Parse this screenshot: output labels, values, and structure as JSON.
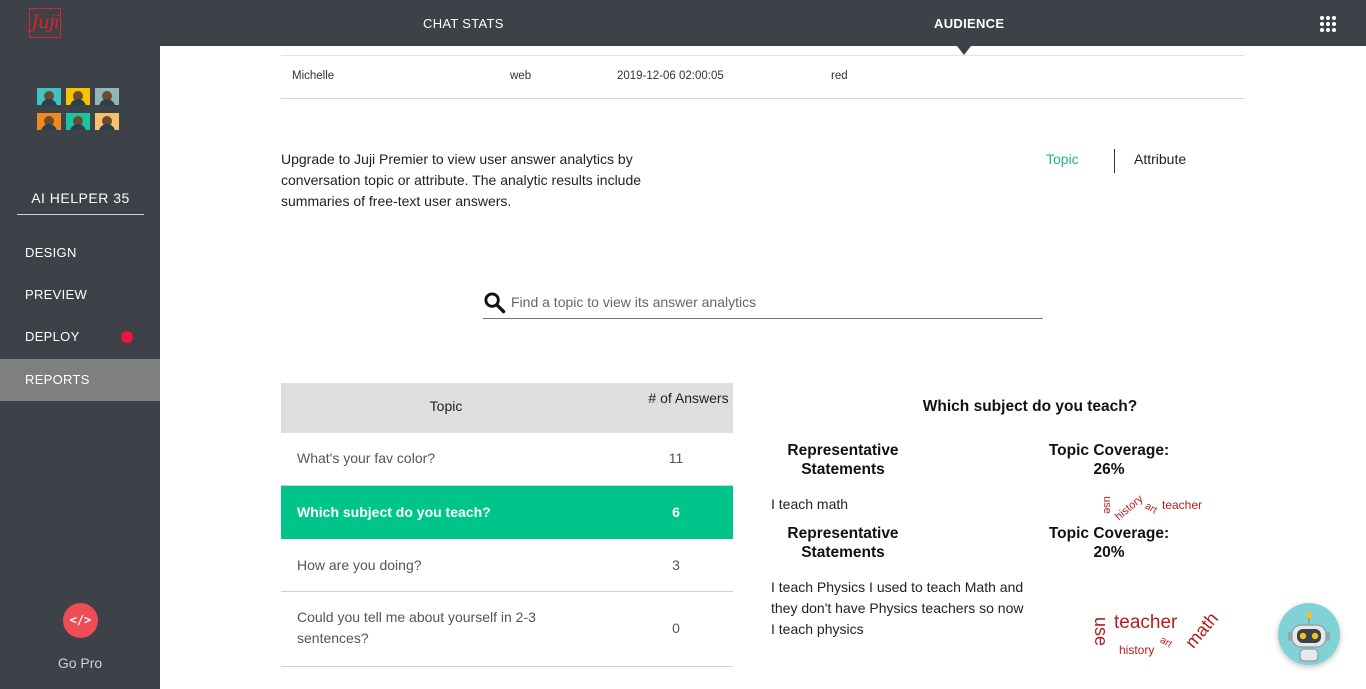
{
  "header": {
    "logo_text": "Juji",
    "tabs": [
      {
        "label": "CHAT STATS",
        "active": false
      },
      {
        "label": "AUDIENCE",
        "active": true
      }
    ]
  },
  "sidebar": {
    "helper_name": "AI HELPER 35",
    "items": [
      {
        "label": "DESIGN"
      },
      {
        "label": "PREVIEW"
      },
      {
        "label": "DEPLOY",
        "badge_color": "#f2133f"
      },
      {
        "label": "REPORTS",
        "active": true
      }
    ],
    "go_pro_icon": "</>",
    "go_pro_label": "Go Pro",
    "avatar_colors": [
      "#3ec4c8",
      "#f7c200",
      "#8fb7b7",
      "#f08a1c",
      "#1bc4a0",
      "#f4c170"
    ]
  },
  "audience_row": {
    "name": "Michelle",
    "channel": "web",
    "timestamp": "2019-12-06 02:00:05",
    "answer": "red"
  },
  "upgrade_text": "Upgrade to Juji Premier to view user answer analytics by conversation topic or attribute. The analytic results include summaries of free-text user answers.",
  "toggle": {
    "topic_label": "Topic",
    "attribute_label": "Attribute",
    "accent": "#1cb68a"
  },
  "search": {
    "placeholder": "Find a topic to view its answer analytics"
  },
  "topic_table": {
    "header_topic": "Topic",
    "header_count": "# of Answers",
    "rows": [
      {
        "topic": "What's your fav color?",
        "count": "11"
      },
      {
        "topic": "Which subject do you teach?",
        "count": "6",
        "selected": true
      },
      {
        "topic": "How are you doing?",
        "count": "3"
      },
      {
        "topic": "Could you tell me about yourself in 2-3 sentences?",
        "count": "0"
      }
    ],
    "selected_color": "#00c58a"
  },
  "analytics": {
    "question": "Which subject do you teach?",
    "groups": [
      {
        "rep_label": "Representative Statements",
        "coverage_label": "Topic Coverage: 26%",
        "statement": "I teach math",
        "words": [
          "use",
          "history",
          "art",
          "teacher"
        ]
      },
      {
        "rep_label": "Representative Statements",
        "coverage_label": "Topic Coverage: 20%",
        "statement": "I teach Physics I used to teach Math and they don't have Physics teachers so now I teach physics",
        "words": [
          "use",
          "teacher",
          "math",
          "history",
          "art"
        ]
      }
    ]
  }
}
